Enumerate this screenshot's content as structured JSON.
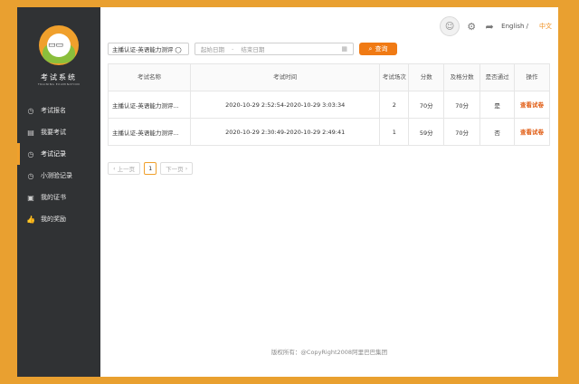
{
  "brand": {
    "title": "考试系统",
    "subtitle": "TRAINING EXAMINATION"
  },
  "sidebar": {
    "items": [
      {
        "label": "考试报名",
        "icon": "clock-icon"
      },
      {
        "label": "我要考试",
        "icon": "document-icon"
      },
      {
        "label": "考试记录",
        "icon": "clock-icon",
        "active": true
      },
      {
        "label": "小测验记录",
        "icon": "clock-icon"
      },
      {
        "label": "我的证书",
        "icon": "certificate-icon"
      },
      {
        "label": "我的奖励",
        "icon": "thumbs-up-icon"
      }
    ]
  },
  "header": {
    "lang_en": "English /",
    "lang_zh": "中文"
  },
  "filters": {
    "exam_select": "主播认证-英语能力测评 ◯",
    "start_placeholder": "起始日期",
    "end_placeholder": "结束日期",
    "dash": "-",
    "search_label": "查询"
  },
  "table": {
    "headers": [
      "考试名称",
      "考试时间",
      "考试场次",
      "分数",
      "及格分数",
      "是否通过",
      "操作"
    ],
    "rows": [
      {
        "name": "主播认证-英语能力测评...",
        "time": "2020-10-29 2:52:54-2020-10-29 3:03:34",
        "session": "2",
        "score": "70分",
        "pass_score": "70分",
        "passed": "是",
        "action": "查看试卷"
      },
      {
        "name": "主播认证-英语能力测评...",
        "time": "2020-10-29 2:30:49-2020-10-29 2:49:41",
        "session": "1",
        "score": "59分",
        "pass_score": "70分",
        "passed": "否",
        "action": "查看试卷"
      }
    ]
  },
  "pager": {
    "prev": "上一页",
    "page": "1",
    "next": "下一页"
  },
  "footer": {
    "text": "版权所有：@CopyRight2008阿里巴巴集团"
  },
  "colors": {
    "accent": "#f07a14",
    "sidebar": "#303234",
    "background": "#e9a030"
  }
}
